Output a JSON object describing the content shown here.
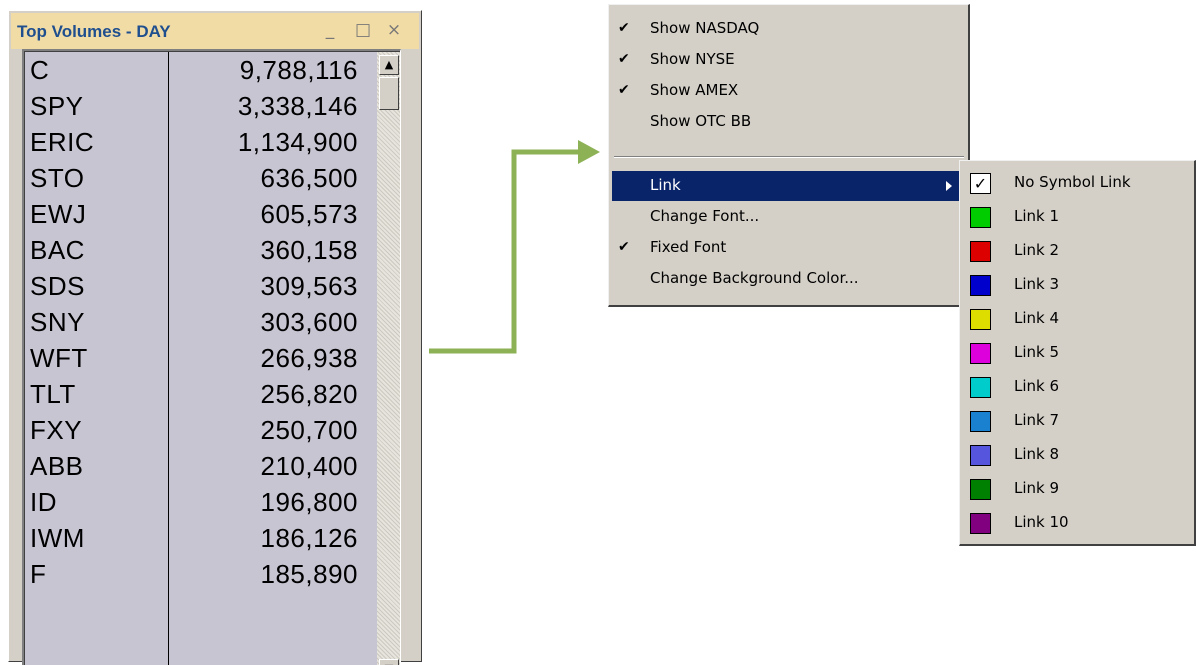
{
  "window": {
    "title": "Top Volumes - DAY",
    "buttons": {
      "minimize": "_",
      "maximize": "□",
      "close": "×"
    },
    "rows": [
      {
        "symbol": "C",
        "volume": "9,788,116"
      },
      {
        "symbol": "SPY",
        "volume": "3,338,146"
      },
      {
        "symbol": "ERIC",
        "volume": "1,134,900"
      },
      {
        "symbol": "STO",
        "volume": "636,500"
      },
      {
        "symbol": "EWJ",
        "volume": "605,573"
      },
      {
        "symbol": "BAC",
        "volume": "360,158"
      },
      {
        "symbol": "SDS",
        "volume": "309,563"
      },
      {
        "symbol": "SNY",
        "volume": "303,600"
      },
      {
        "symbol": "WFT",
        "volume": "266,938"
      },
      {
        "symbol": "TLT",
        "volume": "256,820"
      },
      {
        "symbol": "FXY",
        "volume": "250,700"
      },
      {
        "symbol": "ABB",
        "volume": "210,400"
      },
      {
        "symbol": "ID",
        "volume": "196,800"
      },
      {
        "symbol": "IWM",
        "volume": "186,126"
      },
      {
        "symbol": "F",
        "volume": "185,890"
      }
    ],
    "scroll_up": "▲",
    "scroll_down": "▼"
  },
  "arrow_color": "#8db255",
  "menu": {
    "check_glyph": "✔",
    "items": [
      {
        "label": "Show NASDAQ",
        "checked": true
      },
      {
        "label": "Show NYSE",
        "checked": true
      },
      {
        "label": "Show AMEX",
        "checked": true
      },
      {
        "label": "Show OTC BB",
        "checked": false
      },
      {
        "label": "Link",
        "checked": false,
        "highlighted": true,
        "has_submenu": true
      },
      {
        "label": "Change Font...",
        "checked": false
      },
      {
        "label": "Fixed Font",
        "checked": true
      },
      {
        "label": "Change Background Color...",
        "checked": false
      }
    ]
  },
  "submenu": {
    "checkbox_glyph": "✓",
    "items": [
      {
        "label": "No Symbol Link",
        "checked": true,
        "color": null
      },
      {
        "label": "Link 1",
        "color": "#00cc00"
      },
      {
        "label": "Link 2",
        "color": "#dd0000"
      },
      {
        "label": "Link 3",
        "color": "#0000cc"
      },
      {
        "label": "Link 4",
        "color": "#dddd00"
      },
      {
        "label": "Link 5",
        "color": "#dd00dd"
      },
      {
        "label": "Link 6",
        "color": "#00cccc"
      },
      {
        "label": "Link 7",
        "color": "#1a80d0"
      },
      {
        "label": "Link 8",
        "color": "#5555dd"
      },
      {
        "label": "Link 9",
        "color": "#008000"
      },
      {
        "label": "Link 10",
        "color": "#800080"
      }
    ]
  }
}
